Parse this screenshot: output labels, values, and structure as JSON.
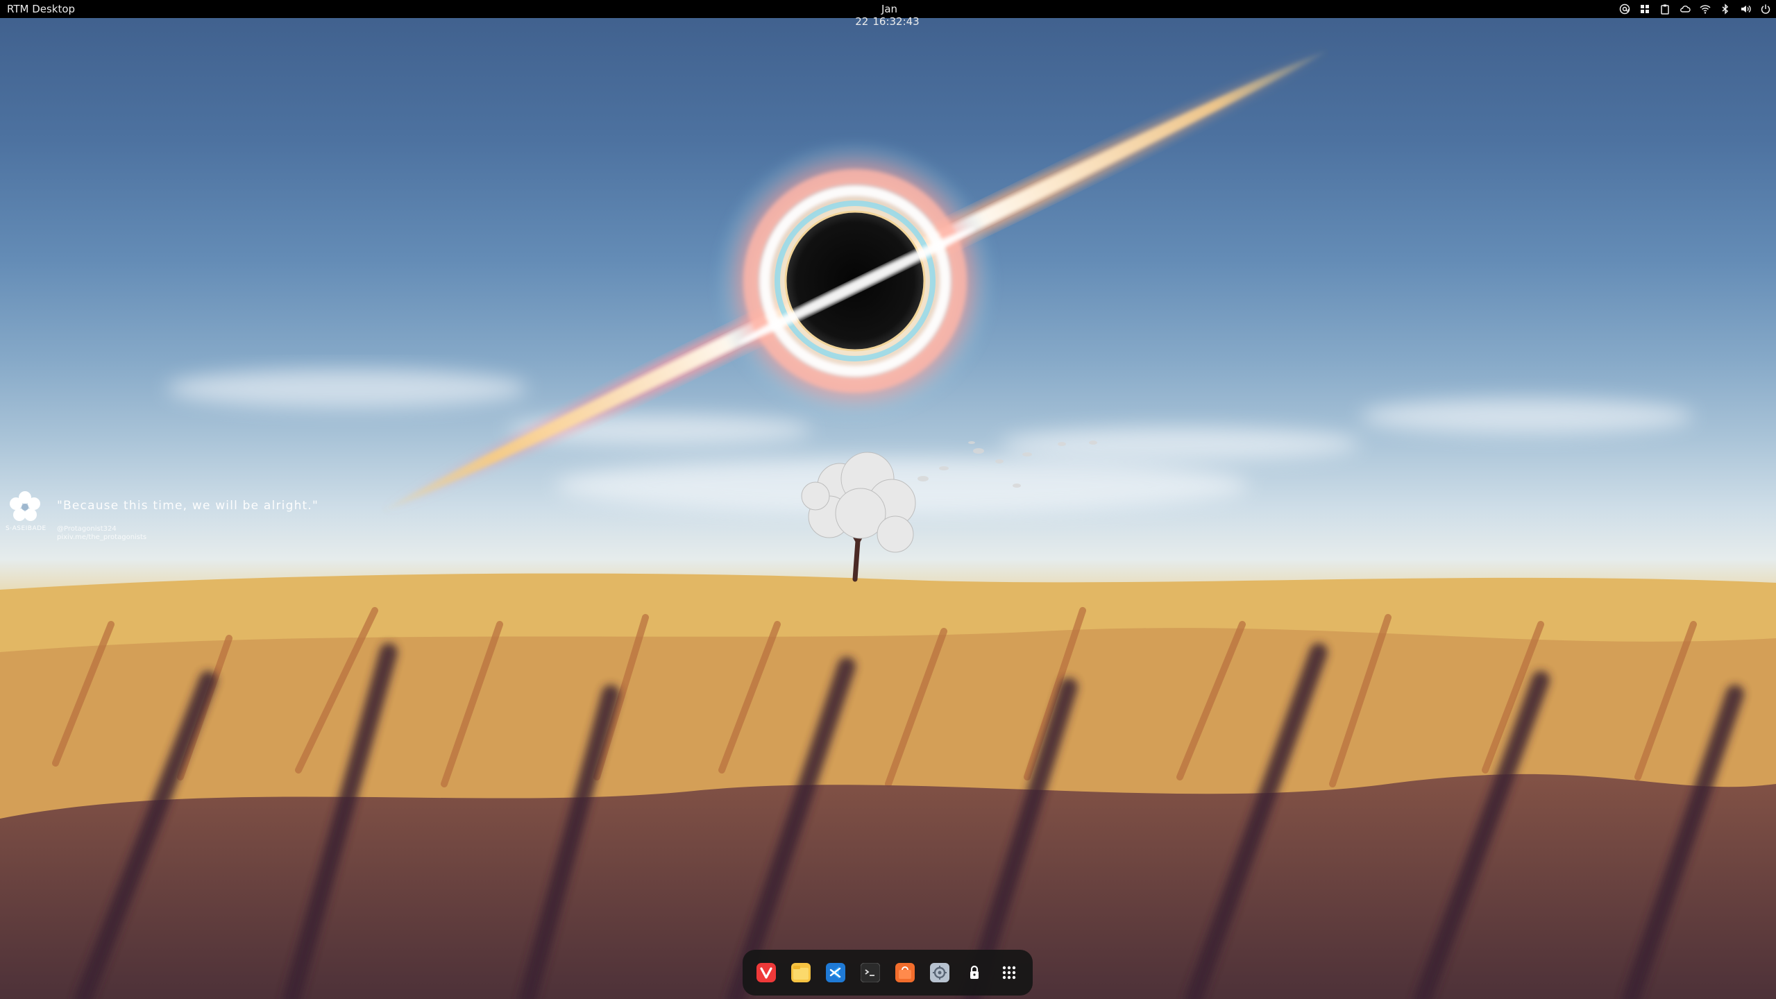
{
  "topbar": {
    "app_title": "RTM Desktop",
    "date": "Jan 22",
    "time": "16:32:43",
    "tray": [
      "at-sign-icon",
      "app-grid-icon",
      "clipboard-icon",
      "cloud-icon",
      "wifi-icon",
      "bluetooth-icon",
      "volume-icon",
      "power-icon"
    ]
  },
  "widget": {
    "brand": "S·ASEIBADE",
    "quote": "\"Because this time, we will be alright.\"",
    "credit_handle": "@Protagonist324",
    "credit_url": "pixiv.me/the_protagonists"
  },
  "dock": {
    "apps": [
      "vivaldi-icon",
      "files-icon",
      "vscode-icon",
      "terminal-icon",
      "store-icon",
      "settings-icon",
      "lock-icon",
      "app-grid-icon"
    ]
  },
  "colors": {
    "sky_top": "#3f5f8c",
    "horizon": "#e6ecec",
    "field": "#dfb45f",
    "dock_bg": "#161616",
    "topbar_bg": "#000000"
  }
}
